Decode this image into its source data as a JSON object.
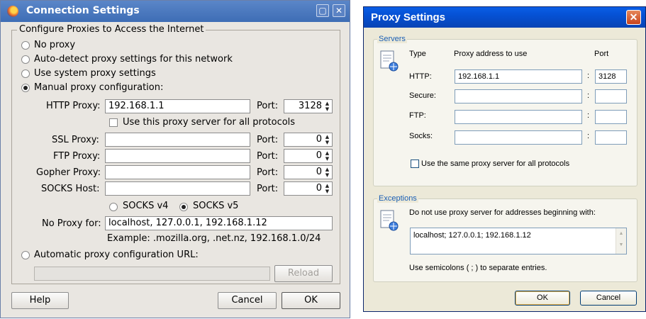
{
  "left_window": {
    "title": "Connection Settings",
    "group_title": "Configure Proxies to Access the Internet",
    "options": {
      "no_proxy": "No proxy",
      "auto_detect": "Auto-detect proxy settings for this network",
      "use_system": "Use system proxy settings",
      "manual": "Manual proxy configuration:",
      "auto_config_url": "Automatic proxy configuration URL:"
    },
    "selected_option": "manual",
    "http_proxy": {
      "label": "HTTP Proxy:",
      "value": "192.168.1.1",
      "port_label": "Port:",
      "port": "3128"
    },
    "same_proxy_label": "Use this proxy server for all protocols",
    "ssl_proxy": {
      "label": "SSL Proxy:",
      "value": "",
      "port_label": "Port:",
      "port": "0"
    },
    "ftp_proxy": {
      "label": "FTP Proxy:",
      "value": "",
      "port_label": "Port:",
      "port": "0"
    },
    "gopher_proxy": {
      "label": "Gopher Proxy:",
      "value": "",
      "port_label": "Port:",
      "port": "0"
    },
    "socks_host": {
      "label": "SOCKS Host:",
      "value": "",
      "port_label": "Port:",
      "port": "0"
    },
    "socks_v4": "SOCKS v4",
    "socks_v5": "SOCKS v5",
    "no_proxy_for": {
      "label": "No Proxy for:",
      "value": "localhost, 127.0.0.1, 192.168.1.12"
    },
    "example": "Example: .mozilla.org, .net.nz, 192.168.1.0/24",
    "auto_config_value": "",
    "reload_label": "Reload",
    "buttons": {
      "help": "Help",
      "cancel": "Cancel",
      "ok": "OK"
    }
  },
  "right_window": {
    "title": "Proxy Settings",
    "close_glyph": "✕",
    "servers_label": "Servers",
    "col_type": "Type",
    "col_address": "Proxy address to use",
    "col_port": "Port",
    "rows": [
      {
        "type": "HTTP:",
        "address": "192.168.1.1",
        "port": "3128"
      },
      {
        "type": "Secure:",
        "address": "",
        "port": ""
      },
      {
        "type": "FTP:",
        "address": "",
        "port": ""
      },
      {
        "type": "Socks:",
        "address": "",
        "port": ""
      }
    ],
    "colon": ":",
    "same_proxy_label": "Use the same proxy server for all protocols",
    "exceptions_label": "Exceptions",
    "exceptions_desc": "Do not use proxy server for addresses beginning with:",
    "exceptions_value": "localhost; 127.0.0.1; 192.168.1.12",
    "exceptions_hint": "Use semicolons ( ; ) to separate entries.",
    "buttons": {
      "ok": "OK",
      "cancel": "Cancel"
    }
  }
}
